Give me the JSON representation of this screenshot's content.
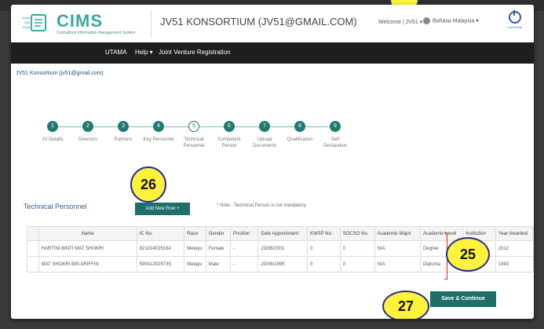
{
  "header": {
    "logo_text": "CIMS",
    "logo_subtitle": "Centralized Information Management System",
    "title": "JV51 KONSORTIUM (JV51@GMAIL.COM)",
    "welcome": "Welcome | JV51 ▾",
    "language": "Bahasa Malaysia ▾",
    "logout_label": "Log Keluar"
  },
  "navbar": {
    "items": [
      "UTAMA",
      "Help ▾",
      "Joint Venture Registration"
    ]
  },
  "breadcrumb": "JV51 Konsortium (jv51@gmail.com)",
  "stepper": {
    "steps": [
      {
        "num": "1",
        "label": "JV Details"
      },
      {
        "num": "2",
        "label": "Directors"
      },
      {
        "num": "3",
        "label": "Partners"
      },
      {
        "num": "4",
        "label": "Key Personnel"
      },
      {
        "num": "5",
        "label": "Technical Personnel"
      },
      {
        "num": "6",
        "label": "Competent Person"
      },
      {
        "num": "7",
        "label": "Upload Documents"
      },
      {
        "num": "8",
        "label": "Qualification"
      },
      {
        "num": "9",
        "label": "Self Declaration"
      }
    ]
  },
  "section": {
    "title": "Technical Personnel",
    "add_button": "Add New Row +",
    "note": "* Note - Technical Person is not mandatory."
  },
  "table": {
    "headers": [
      "",
      "Name",
      "IC No.",
      "Race",
      "Gender",
      "Position",
      "Date Appointment",
      "KWSP No.",
      "SOCSO No.",
      "Academic Major",
      "Academic Level",
      "Institution",
      "Year Awarded"
    ],
    "rows": [
      [
        "",
        "HARTINI BINTI MAT SHOKRI",
        "821024025164",
        "Melayu",
        "Female",
        "-",
        "23/06/2001",
        "0",
        "0",
        "N/A",
        "Degree",
        "",
        "2012"
      ],
      [
        "",
        "MAT SHOKRI BIN ARIFFIN",
        "590412025735",
        "Melayu",
        "Male",
        "-",
        "20/06/1995",
        "0",
        "0",
        "N/A",
        "Diploma",
        "",
        "1983"
      ]
    ]
  },
  "save_button": "Save & Continue",
  "callouts": [
    "26",
    "25",
    "27"
  ],
  "colors": {
    "primary": "#1f6f68",
    "callout": "#fff23a",
    "navbar": "#1e1e1e"
  }
}
